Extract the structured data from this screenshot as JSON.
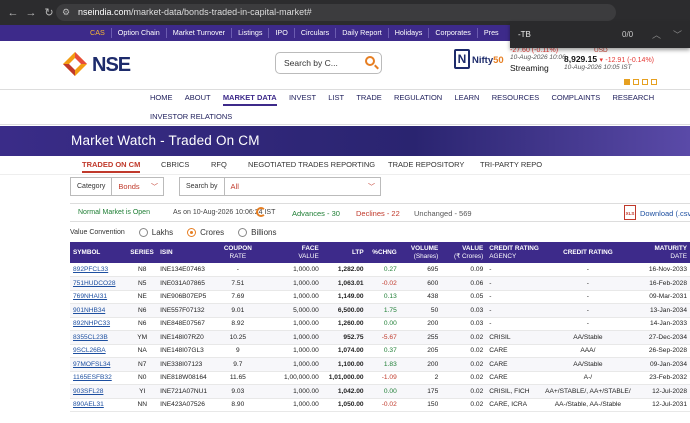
{
  "browser": {
    "url_domain": "nseindia.com",
    "url_path": "/market-data/bonds-traded-in-capital-market#"
  },
  "findbar": {
    "query": "-TB",
    "count": "0/0"
  },
  "topnav": {
    "items": [
      "CAS",
      "Option Chain",
      "Market Turnover",
      "Listings",
      "IPO",
      "Circulars",
      "Daily Report",
      "Holidays",
      "Corporates",
      "Pres"
    ]
  },
  "header": {
    "logo_text": "NSE",
    "search_placeholder": "Search by C...",
    "nifty_label": "Nifty",
    "nifty_num": "50"
  },
  "ticker1": {
    "change": "-27.60 (-0.11%)",
    "time": "10-Aug-2026 10:06",
    "status": "Streaming"
  },
  "ticker2": {
    "label": "USD",
    "value": "8,929.15",
    "change": "-12.91 (-0.14%)",
    "time": "10-Aug-2026 10:05 IST"
  },
  "mainnav": {
    "row1": [
      "HOME",
      "ABOUT",
      "MARKET DATA",
      "INVEST",
      "LIST",
      "TRADE",
      "REGULATION",
      "LEARN",
      "RESOURCES",
      "COMPLAINTS",
      "RESEARCH"
    ],
    "row2": [
      "INVESTOR RELATIONS"
    ],
    "active": "MARKET DATA"
  },
  "page": {
    "title": "Market Watch - Traded On CM"
  },
  "subtabs": [
    "TRADED ON CM",
    "CBRICS",
    "RFQ",
    "NEGOTIATED TRADES REPORTING",
    "TRADE REPOSITORY",
    "TRI-PARTY REPO"
  ],
  "filters": {
    "category_label": "Category",
    "category_value": "Bonds",
    "searchby_label": "Search by",
    "searchby_value": "All"
  },
  "market": {
    "status": "Normal Market is Open",
    "asof": "As on 10-Aug-2026 10:06:24 IST",
    "advances": "Advances - 30",
    "declines": "Declines - 22",
    "unchanged": "Unchanged - 569",
    "download": "Download (.csv)",
    "xls_label": "XLS"
  },
  "value_convention": {
    "label": "Value Convention",
    "options": [
      "Lakhs",
      "Crores",
      "Billions"
    ],
    "selected": "Crores"
  },
  "table": {
    "headers": [
      "SYMBOL",
      "SERIES",
      "ISIN",
      "COUPON|RATE",
      "FACE|VALUE",
      "LTP",
      "%CHNG",
      "VOLUME|(Shares)",
      "VALUE|(₹ Crores)",
      "CREDIT RATING|AGENCY",
      "CREDIT RATING",
      "MATURITY|DATE"
    ],
    "rows": [
      [
        "892PFCL33",
        "N8",
        "INE134E07463",
        "-",
        "1,000.00",
        "1,282.00",
        "0.27",
        "695",
        "0.09",
        "-",
        "-",
        "16-Nov-2033"
      ],
      [
        "751HUDCO28",
        "N5",
        "INE031A07865",
        "7.51",
        "1,000.00",
        "1,063.01",
        "-0.02",
        "600",
        "0.06",
        "-",
        "-",
        "16-Feb-2028"
      ],
      [
        "769NHAI31",
        "NE",
        "INE906B07EP5",
        "7.69",
        "1,000.00",
        "1,149.00",
        "0.13",
        "438",
        "0.05",
        "-",
        "-",
        "09-Mar-2031"
      ],
      [
        "901NHB34",
        "N6",
        "INE557F07132",
        "9.01",
        "5,000.00",
        "6,500.00",
        "1.75",
        "50",
        "0.03",
        "-",
        "-",
        "13-Jan-2034"
      ],
      [
        "892NHPC33",
        "N6",
        "INE848E07567",
        "8.92",
        "1,000.00",
        "1,260.00",
        "0.00",
        "200",
        "0.03",
        "-",
        "-",
        "14-Jan-2033"
      ],
      [
        "8355CL23B",
        "YM",
        "INE148I07RZ0",
        "10.25",
        "1,000.00",
        "952.75",
        "-5.67",
        "255",
        "0.02",
        "CRISIL",
        "AA/Stable",
        "27-Dec-2034"
      ],
      [
        "9SCL26BA",
        "NA",
        "INE148I07GL3",
        "9",
        "1,000.00",
        "1,074.00",
        "0.37",
        "205",
        "0.02",
        "CARE",
        "AAA/",
        "26-Sep-2028"
      ],
      [
        "97MOFSL34",
        "N7",
        "INE338I07123",
        "9.7",
        "1,000.00",
        "1,100.00",
        "1.83",
        "200",
        "0.02",
        "CARE",
        "AA/Stable",
        "09-Jan-2034"
      ],
      [
        "1165ESFB32",
        "N0",
        "INE818W08164",
        "11.65",
        "1,00,000.00",
        "1,01,000.00",
        "-1.09",
        "2",
        "0.02",
        "CARE",
        "A-/",
        "23-Feb-2032"
      ],
      [
        "903SFL28",
        "YI",
        "INE721A07NU1",
        "9.03",
        "1,000.00",
        "1,042.00",
        "0.00",
        "175",
        "0.02",
        "CRISIL, FICH",
        "AA+/STABLE/, AA+/STABLE/",
        "12-Jul-2028"
      ],
      [
        "890AEL31",
        "NN",
        "INE423A07526",
        "8.90",
        "1,000.00",
        "1,050.00",
        "-0.02",
        "150",
        "0.02",
        "CARE, ICRA",
        "AA-/Stable, AA-/Stable",
        "12-Jul-2031"
      ]
    ]
  }
}
